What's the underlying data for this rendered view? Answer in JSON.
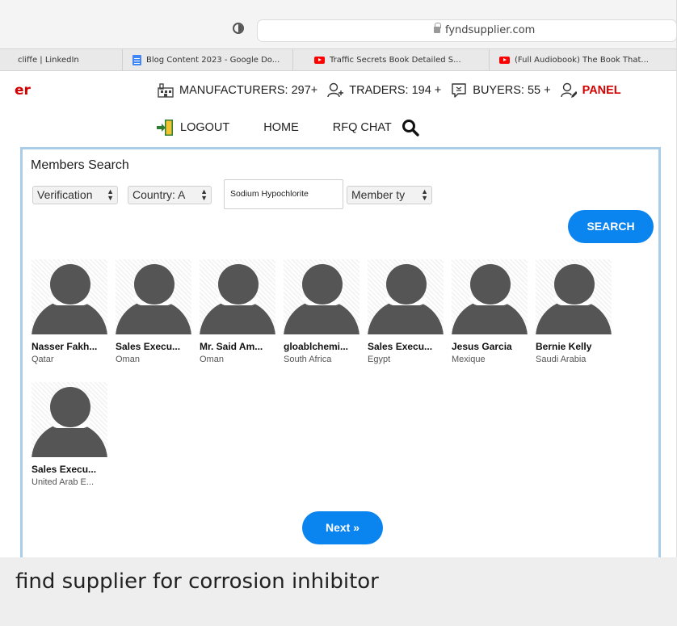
{
  "browser": {
    "url": "fyndsupplier.com",
    "tabs": [
      {
        "title": "cliffe | LinkedIn",
        "icon": "none"
      },
      {
        "title": "Blog Content 2023 - Google Do...",
        "icon": "google-docs-icon"
      },
      {
        "title": "Traffic Secrets Book Detailed S...",
        "icon": "youtube-icon"
      },
      {
        "title": "(Full Audiobook) The Book That...",
        "icon": "youtube-icon"
      }
    ]
  },
  "header": {
    "brand_fragment": "er",
    "stats": {
      "manufacturers": "MANUFACTURERS: 297+",
      "traders": "TRADERS: 194 +",
      "buyers": "BUYERS: 55 +",
      "panel": "PANEL"
    },
    "nav": {
      "logout": "LOGOUT",
      "home": "HOME",
      "rfq_chat": "RFQ CHAT"
    }
  },
  "members_search": {
    "title": "Members Search",
    "filters": {
      "verification": "Verification",
      "country": "Country: A",
      "member_type": "Member ty"
    },
    "search_value": "Sodium Hypochlorite",
    "search_button": "SEARCH",
    "members": [
      {
        "name": "Nasser Fakh...",
        "country": "Qatar",
        "online": true
      },
      {
        "name": "Sales Execu...",
        "country": "Oman",
        "online": true
      },
      {
        "name": "Mr. Said Am...",
        "country": "Oman",
        "online": true
      },
      {
        "name": "gloablchemi...",
        "country": "South Africa",
        "online": true
      },
      {
        "name": "Sales Execu...",
        "country": "Egypt",
        "online": true
      },
      {
        "name": "Jesus Garcia",
        "country": "Mexique",
        "online": true
      },
      {
        "name": "Bernie Kelly",
        "country": "Saudi Arabia",
        "online": true
      },
      {
        "name": "Sales Execu...",
        "country": "United Arab E...",
        "online": true
      }
    ],
    "next_button": "Next »"
  },
  "caption": "find supplier for corrosion inhibitor",
  "colors": {
    "accent_blue": "#0a84ef",
    "panel_border": "#a9cde8",
    "brand_red": "#d30000",
    "avatar_gray": "#555555",
    "online_green": "#2db52d"
  }
}
